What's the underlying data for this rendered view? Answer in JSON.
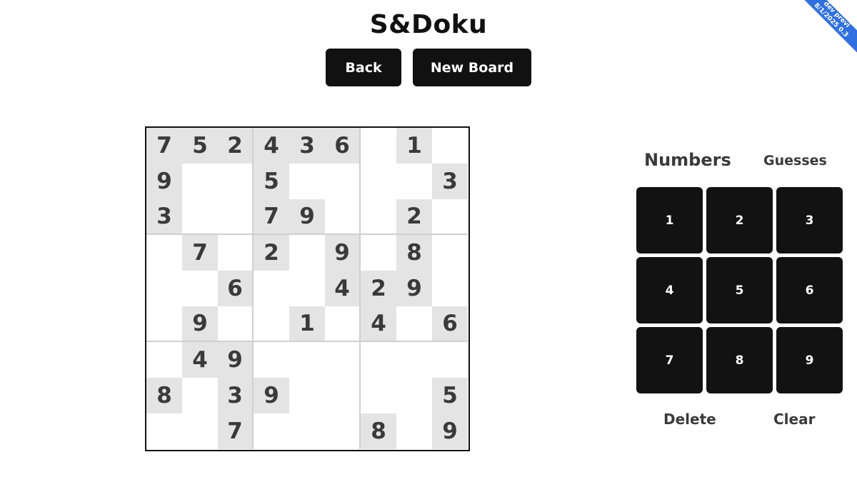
{
  "title": "S&Doku",
  "buttons": {
    "back": "Back",
    "new_board": "New Board"
  },
  "board": {
    "rows": [
      [
        "7",
        "5",
        "2",
        "4",
        "3",
        "6",
        "",
        "1",
        ""
      ],
      [
        "9",
        "",
        "",
        "5",
        "",
        "",
        "",
        "",
        "3"
      ],
      [
        "3",
        "",
        "",
        "7",
        "9",
        "",
        "",
        "2",
        ""
      ],
      [
        "",
        "7",
        "",
        "2",
        "",
        "9",
        "",
        "8",
        ""
      ],
      [
        "",
        "",
        "6",
        "",
        "",
        "4",
        "2",
        "9",
        ""
      ],
      [
        "",
        "9",
        "",
        "",
        "1",
        "",
        "4",
        "",
        "6"
      ],
      [
        "",
        "4",
        "9",
        "",
        "",
        "",
        "",
        "",
        ""
      ],
      [
        "8",
        "",
        "3",
        "9",
        "",
        "",
        "",
        "",
        "5"
      ],
      [
        "",
        "",
        "7",
        "",
        "",
        "",
        "8",
        "",
        "9"
      ]
    ]
  },
  "panel": {
    "tab_numbers": "Numbers",
    "tab_guesses": "Guesses",
    "keys": [
      "1",
      "2",
      "3",
      "4",
      "5",
      "6",
      "7",
      "8",
      "9"
    ],
    "delete_label": "Delete",
    "clear_label": "Clear"
  },
  "ribbon": {
    "line1": "dev previ",
    "line2": "8/1/2025 0.3"
  },
  "colors": {
    "key_bg": "#121212",
    "given_bg": "#e4e4e4",
    "ribbon": "#2f6fe0"
  }
}
